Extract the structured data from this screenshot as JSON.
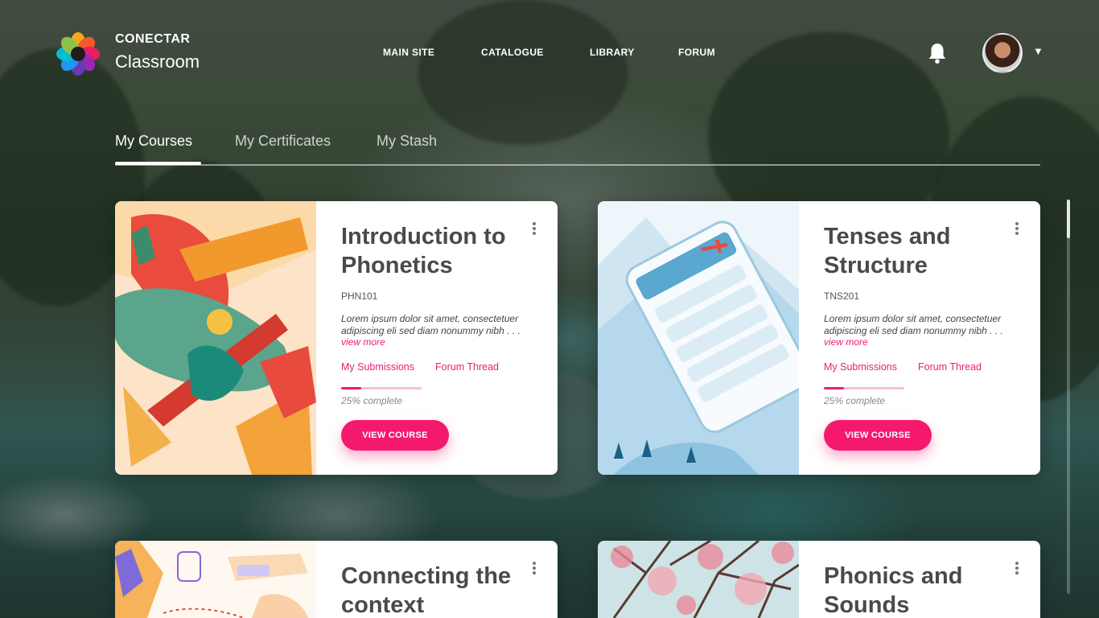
{
  "brand": {
    "top": "CONECTAR",
    "bottom": "Classroom"
  },
  "nav": [
    "MAIN SITE",
    "CATALOGUE",
    "LIBRARY",
    "FORUM"
  ],
  "tabs": [
    "My Courses",
    "My Certificates",
    "My Stash"
  ],
  "accent": "#f5196e",
  "courses": [
    {
      "title": "Introduction to Phonetics",
      "code": "PHN101",
      "desc": "Lorem ipsum dolor sit amet, consectetuer adipiscing eli sed diam nonummy nibh . . .",
      "more": "view more",
      "submissions": "My Submissions",
      "forum": "Forum Thread",
      "progress_pct": 25,
      "progress_text": "25% complete",
      "button": "VIEW COURSE"
    },
    {
      "title": "Tenses and Structure",
      "code": "TNS201",
      "desc": "Lorem ipsum dolor sit amet, consectetuer adipiscing eli sed diam nonummy nibh . . .",
      "more": "view more",
      "submissions": "My Submissions",
      "forum": "Forum Thread",
      "progress_pct": 25,
      "progress_text": "25% complete",
      "button": "VIEW COURSE"
    },
    {
      "title": "Connecting the context"
    },
    {
      "title": "Phonics and Sounds"
    }
  ]
}
